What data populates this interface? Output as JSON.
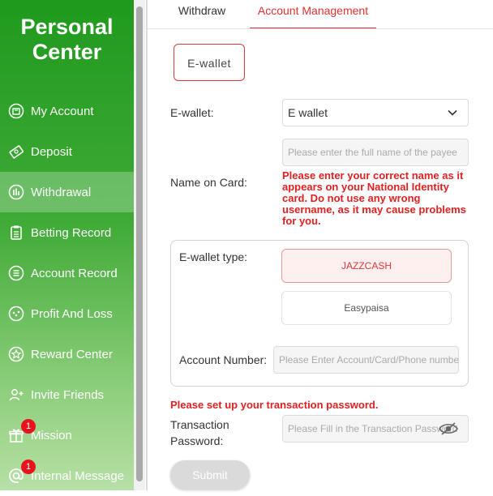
{
  "sidebar": {
    "title_line1": "Personal",
    "title_line2": "Center",
    "items": [
      {
        "label": "My Account",
        "icon": "account-icon"
      },
      {
        "label": "Deposit",
        "icon": "deposit-icon"
      },
      {
        "label": "Withdrawal",
        "icon": "withdrawal-icon",
        "active": true
      },
      {
        "label": "Betting Record",
        "icon": "betting-record-icon"
      },
      {
        "label": "Account Record",
        "icon": "account-record-icon"
      },
      {
        "label": "Profit And Loss",
        "icon": "profit-loss-icon"
      },
      {
        "label": "Reward Center",
        "icon": "reward-icon"
      },
      {
        "label": "Invite Friends",
        "icon": "invite-icon"
      },
      {
        "label": "Mission",
        "icon": "gift-icon",
        "badge": "1"
      },
      {
        "label": "Internal Message",
        "icon": "at-icon",
        "badge": "1"
      }
    ]
  },
  "tabs": {
    "withdraw": "Withdraw",
    "account_management": "Account Management"
  },
  "form": {
    "method_tab": "E-wallet",
    "ewallet_label": "E-wallet:",
    "ewallet_value": "E wallet",
    "name_label": "Name on Card:",
    "name_placeholder": "Please enter the full name of the payee",
    "name_warning": "Please enter your correct name as it appears on your National Identity card. Do not use any wrong username, as it may cause problems for you.",
    "type_label": "E-wallet type:",
    "type_options": [
      "JAZZCASH",
      "Easypaisa"
    ],
    "selected_type": "JAZZCASH",
    "account_label": "Account Number:",
    "account_placeholder": "Please Enter Account/Card/Phone number",
    "tx_warning": "Please set up your transaction password.",
    "tx_label_line1": "Transaction",
    "tx_label_line2": "Password:",
    "tx_placeholder": "Please Fill in the Transaction Password",
    "submit": "Submit"
  },
  "colors": {
    "accent_red": "#e03131",
    "sidebar_green": "#1f9a1d"
  }
}
